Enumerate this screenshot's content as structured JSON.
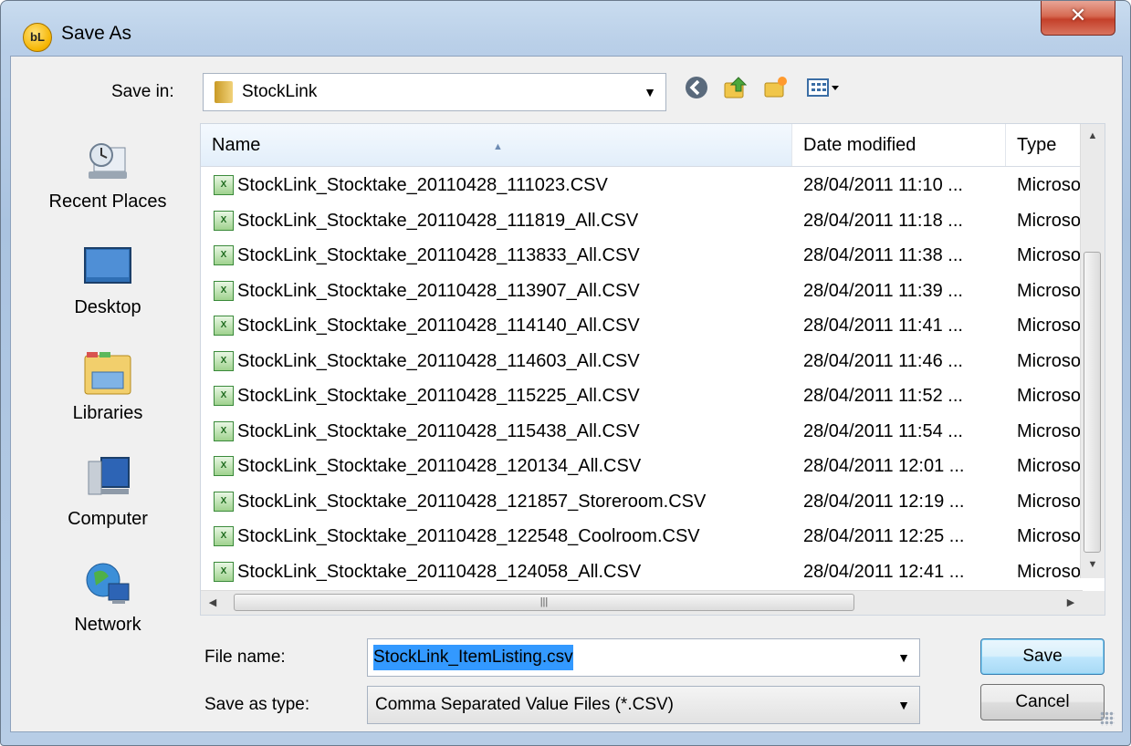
{
  "window": {
    "title": "Save As",
    "app_icon_text": "bL",
    "close_glyph": "✕"
  },
  "save_in": {
    "label": "Save in:",
    "value": "StockLink"
  },
  "places": [
    {
      "label": "Recent Places",
      "icon": "recent-places-icon"
    },
    {
      "label": "Desktop",
      "icon": "desktop-icon"
    },
    {
      "label": "Libraries",
      "icon": "libraries-icon"
    },
    {
      "label": "Computer",
      "icon": "computer-icon"
    },
    {
      "label": "Network",
      "icon": "network-icon"
    }
  ],
  "columns": {
    "name": "Name",
    "date": "Date modified",
    "type": "Type"
  },
  "files": [
    {
      "name": "StockLink_Stocktake_20110428_111023.CSV",
      "date": "28/04/2011 11:10 ...",
      "type": "Microsoft"
    },
    {
      "name": "StockLink_Stocktake_20110428_111819_All.CSV",
      "date": "28/04/2011 11:18 ...",
      "type": "Microsoft"
    },
    {
      "name": "StockLink_Stocktake_20110428_113833_All.CSV",
      "date": "28/04/2011 11:38 ...",
      "type": "Microsoft"
    },
    {
      "name": "StockLink_Stocktake_20110428_113907_All.CSV",
      "date": "28/04/2011 11:39 ...",
      "type": "Microsoft"
    },
    {
      "name": "StockLink_Stocktake_20110428_114140_All.CSV",
      "date": "28/04/2011 11:41 ...",
      "type": "Microsoft"
    },
    {
      "name": "StockLink_Stocktake_20110428_114603_All.CSV",
      "date": "28/04/2011 11:46 ...",
      "type": "Microsoft"
    },
    {
      "name": "StockLink_Stocktake_20110428_115225_All.CSV",
      "date": "28/04/2011 11:52 ...",
      "type": "Microsoft"
    },
    {
      "name": "StockLink_Stocktake_20110428_115438_All.CSV",
      "date": "28/04/2011 11:54 ...",
      "type": "Microsoft"
    },
    {
      "name": "StockLink_Stocktake_20110428_120134_All.CSV",
      "date": "28/04/2011 12:01 ...",
      "type": "Microsoft"
    },
    {
      "name": "StockLink_Stocktake_20110428_121857_Storeroom.CSV",
      "date": "28/04/2011 12:19 ...",
      "type": "Microsoft"
    },
    {
      "name": "StockLink_Stocktake_20110428_122548_Coolroom.CSV",
      "date": "28/04/2011 12:25 ...",
      "type": "Microsoft"
    },
    {
      "name": "StockLink_Stocktake_20110428_124058_All.CSV",
      "date": "28/04/2011 12:41 ...",
      "type": "Microsoft"
    }
  ],
  "file_name": {
    "label": "File name:",
    "value": "StockLink_ItemListing.csv"
  },
  "save_type": {
    "label": "Save as type:",
    "value": "Comma Separated Value Files (*.CSV)"
  },
  "buttons": {
    "save": "Save",
    "cancel": "Cancel"
  },
  "colors": {
    "selection": "#3399ff",
    "close": "#c4402a",
    "default_button": "#3c7fb1"
  }
}
